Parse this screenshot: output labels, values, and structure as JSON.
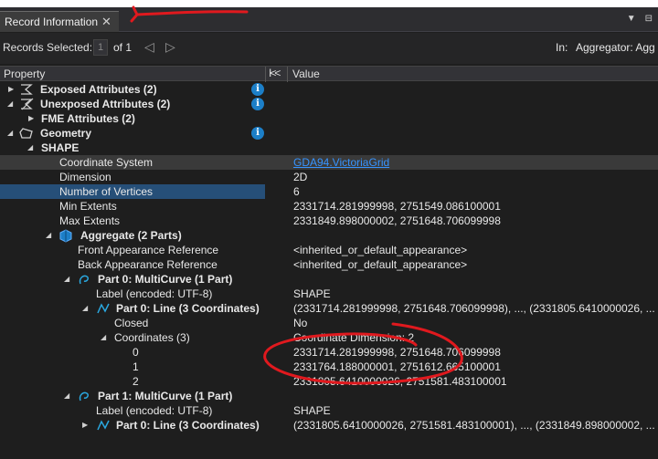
{
  "tab": {
    "title": "Record Information",
    "close": "✕"
  },
  "tabbar_icons": {
    "dropdown": "▼",
    "pin": "⊟"
  },
  "records": {
    "label": "Records Selected:",
    "current": "1",
    "of": "of 1",
    "prev": "◁",
    "next": "▷",
    "in_label": "In:",
    "in_value": "Aggregator: Agg"
  },
  "header": {
    "property": "Property",
    "collapse": "I<<",
    "value": "Value"
  },
  "info_glyph": "i",
  "rows": [
    {
      "label": "Exposed Attributes (2)",
      "value": ""
    },
    {
      "label": "Unexposed Attributes (2)",
      "value": ""
    },
    {
      "label": "FME Attributes (2)",
      "value": ""
    },
    {
      "label": "Geometry",
      "value": ""
    },
    {
      "label": "SHAPE",
      "value": ""
    },
    {
      "label": "Coordinate System",
      "value": "GDA94.VictoriaGrid"
    },
    {
      "label": "Dimension",
      "value": "2D"
    },
    {
      "label": "Number of Vertices",
      "value": "6"
    },
    {
      "label": "Min Extents",
      "value": "2331714.281999998, 2751549.086100001"
    },
    {
      "label": "Max Extents",
      "value": "2331849.898000002, 2751648.706099998"
    },
    {
      "label": "Aggregate (2 Parts)",
      "value": ""
    },
    {
      "label": "Front Appearance Reference",
      "value": "<inherited_or_default_appearance>"
    },
    {
      "label": "Back Appearance Reference",
      "value": "<inherited_or_default_appearance>"
    },
    {
      "label": "Part 0: MultiCurve (1 Part)",
      "value": ""
    },
    {
      "label": "Label (encoded: UTF-8)",
      "value": "SHAPE"
    },
    {
      "label": "Part 0: Line (3 Coordinates)",
      "value": "(2331714.281999998, 2751648.706099998), ..., (2331805.6410000026, ..."
    },
    {
      "label": "Closed",
      "value": "No"
    },
    {
      "label": "Coordinates (3)",
      "value": "Coordinate Dimension: 2"
    },
    {
      "label": "0",
      "value": "2331714.281999998, 2751648.706099998"
    },
    {
      "label": "1",
      "value": "2331764.188000001, 2751612.665100001"
    },
    {
      "label": "2",
      "value": "2331805.6410000026, 2751581.483100001"
    },
    {
      "label": "Part 1: MultiCurve (1 Part)",
      "value": ""
    },
    {
      "label": "Label (encoded: UTF-8)",
      "value": "SHAPE"
    },
    {
      "label": "Part 0: Line (3 Coordinates)",
      "value": "(2331805.6410000026, 2751581.483100001), ..., (2331849.898000002, ..."
    }
  ],
  "colors": {
    "accent_blue": "#264f78",
    "link": "#3794ff",
    "annotation_red": "#e0191e"
  },
  "icons": [
    "exposed-attributes-icon",
    "unexposed-attributes-icon",
    "geometry-icon",
    "aggregate-icon",
    "multicurve-icon",
    "line-icon",
    "info-icon"
  ]
}
